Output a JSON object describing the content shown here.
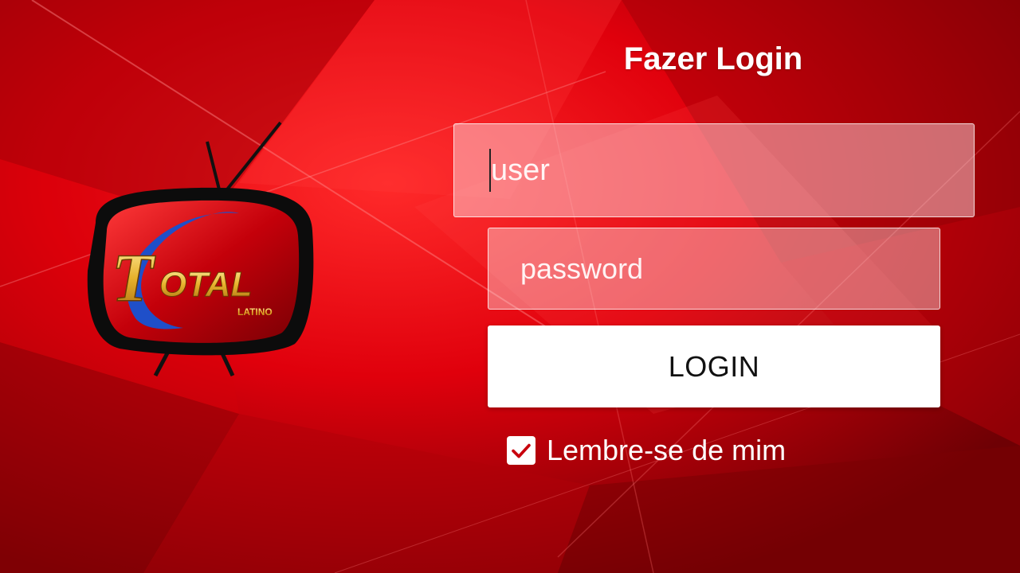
{
  "app": {
    "logo_text": "TOTAL",
    "logo_subtext": "LATINO"
  },
  "login": {
    "title": "Fazer Login",
    "user_placeholder": "user",
    "password_placeholder": "password",
    "button_label": "LOGIN",
    "remember_label": "Lembre-se de mim",
    "remember_checked": true
  },
  "icons": {
    "checkbox": "checkmark-icon",
    "logo": "tv-logo-icon"
  },
  "colors": {
    "background": "#c80008",
    "button_bg": "#ffffff",
    "text": "#ffffff"
  }
}
